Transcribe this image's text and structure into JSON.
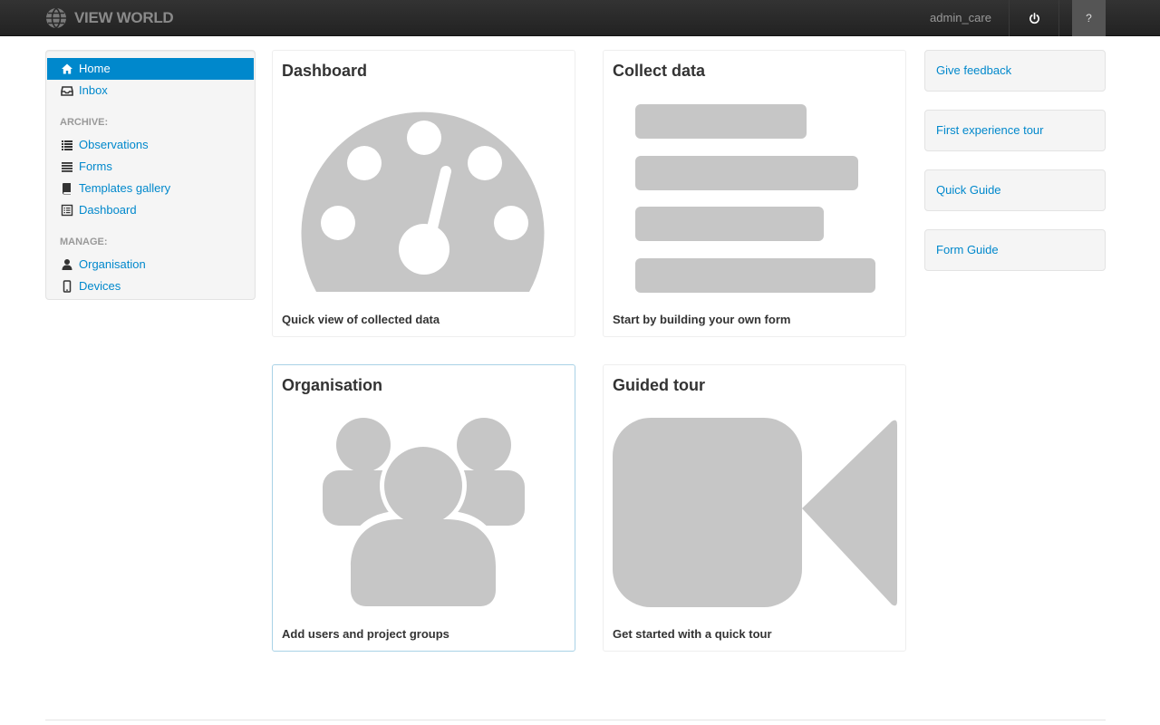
{
  "navbar": {
    "brand": "VIEW WORLD",
    "user": "admin_care",
    "help": "?"
  },
  "sidebar": {
    "items_top": [
      {
        "label": "Home",
        "icon": "home-icon",
        "active": true
      },
      {
        "label": "Inbox",
        "icon": "inbox-icon"
      }
    ],
    "archive_header": "ARCHIVE:",
    "archive_items": [
      {
        "label": "Observations",
        "icon": "list-icon"
      },
      {
        "label": "Forms",
        "icon": "align-justify-icon"
      },
      {
        "label": "Templates gallery",
        "icon": "book-icon"
      },
      {
        "label": "Dashboard",
        "icon": "list-alt-icon"
      }
    ],
    "manage_header": "MANAGE:",
    "manage_items": [
      {
        "label": "Organisation",
        "icon": "user-icon"
      },
      {
        "label": "Devices",
        "icon": "phone-icon"
      }
    ]
  },
  "tiles": {
    "dashboard": {
      "title": "Dashboard",
      "desc": "Quick view of collected data"
    },
    "collect": {
      "title": "Collect data",
      "desc": "Start by building your own form"
    },
    "organisation": {
      "title": "Organisation",
      "desc": "Add users and project groups"
    },
    "tour": {
      "title": "Guided tour",
      "desc": "Get started with a quick tour"
    }
  },
  "right_links": [
    "Give feedback",
    "First experience tour",
    "Quick Guide",
    "Form Guide"
  ],
  "colors": {
    "accent": "#0088cc",
    "icon_gray": "#c6c6c6",
    "navbar": "#2a2a2a"
  }
}
